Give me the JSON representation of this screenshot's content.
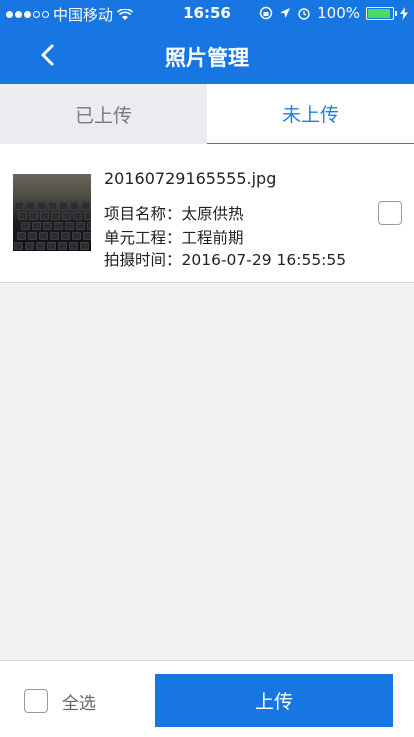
{
  "status_bar": {
    "carrier": "中国移动",
    "time": "16:56",
    "battery_text": "100%"
  },
  "nav": {
    "title": "照片管理",
    "back_icon": "chevron-left-icon"
  },
  "tabs": [
    {
      "label": "已上传",
      "active": false
    },
    {
      "label": "未上传",
      "active": true
    }
  ],
  "photos": [
    {
      "filename": "20160729165555.jpg",
      "project": "项目名称：太原供热",
      "unit": "单元工程：工程前期",
      "time": "拍摄时间：2016-07-29 16:55:55",
      "checked": false
    }
  ],
  "footer": {
    "select_all_label": "全选",
    "upload_label": "上传"
  },
  "colors": {
    "primary": "#1776e2",
    "tab_active_text": "#1f7fe6"
  }
}
